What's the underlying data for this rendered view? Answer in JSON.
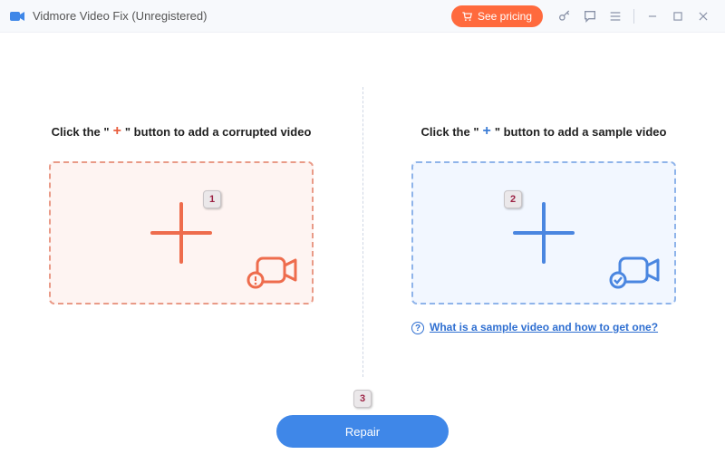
{
  "titlebar": {
    "app_title": "Vidmore Video Fix (Unregistered)",
    "pricing_label": "See pricing"
  },
  "left": {
    "instruction_prefix": "Click the \"",
    "instruction_suffix": "\" button to add a corrupted video"
  },
  "right": {
    "instruction_prefix": "Click the \"",
    "instruction_suffix": "\" button to add a sample video",
    "help_text": "What is a sample video and how to get one?"
  },
  "repair_label": "Repair",
  "badges": {
    "one": "1",
    "two": "2",
    "three": "3"
  }
}
